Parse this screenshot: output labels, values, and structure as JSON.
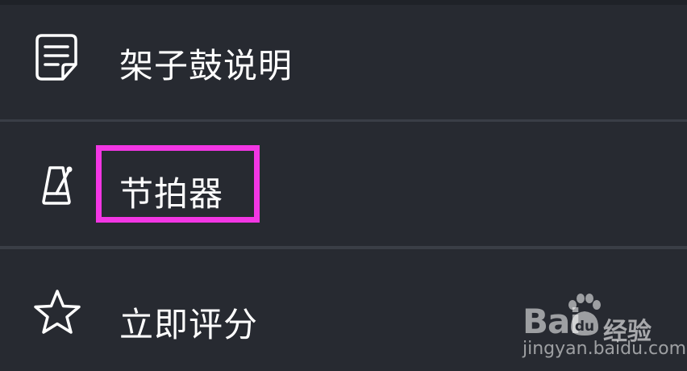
{
  "menu": {
    "items": [
      {
        "label": "架子鼓说明",
        "icon": "document-icon"
      },
      {
        "label": "节拍器",
        "icon": "metronome-icon"
      },
      {
        "label": "立即评分",
        "icon": "star-icon"
      }
    ]
  },
  "watermark": {
    "brand": "Bai",
    "brand_suffix": "du",
    "product": "经验",
    "url": "jingyan.baidu.com"
  },
  "colors": {
    "background": "#272a31",
    "divider": "#3a3e46",
    "text": "#ffffff",
    "highlight": "#f236e3"
  }
}
